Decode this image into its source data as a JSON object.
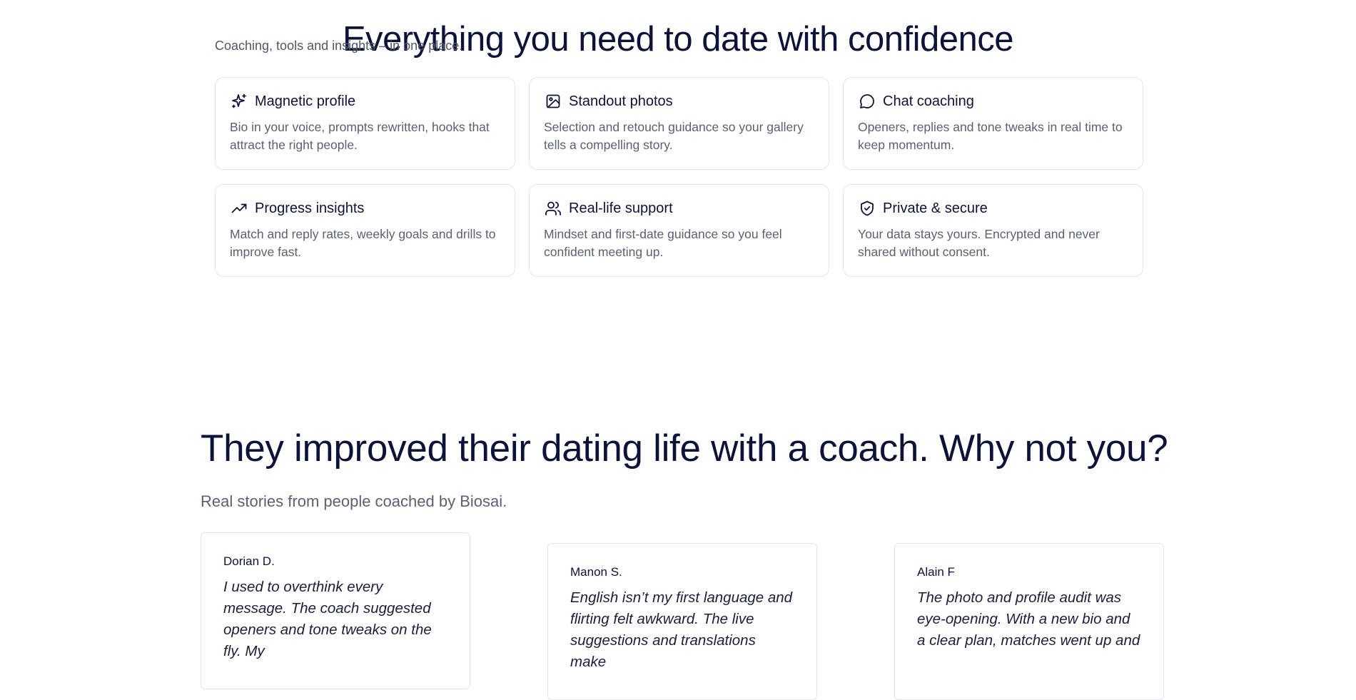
{
  "features": {
    "title": "Everything you need to date with confidence",
    "subtitle": "Coaching, tools and insights – in one place.",
    "cards": [
      {
        "icon": "sparkle-icon",
        "title": "Magnetic profile",
        "desc": "Bio in your voice, prompts rewritten, hooks that attract the right people."
      },
      {
        "icon": "image-icon",
        "title": "Standout photos",
        "desc": "Selection and retouch guidance so your gallery tells a compelling story."
      },
      {
        "icon": "chat-bubble-icon",
        "title": "Chat coaching",
        "desc": "Openers, replies and tone tweaks in real time to keep momentum."
      },
      {
        "icon": "trending-up-icon",
        "title": "Progress insights",
        "desc": "Match and reply rates, weekly goals and drills to improve fast."
      },
      {
        "icon": "users-icon",
        "title": "Real-life support",
        "desc": "Mindset and first-date guidance so you feel confident meeting up."
      },
      {
        "icon": "shield-check-icon",
        "title": "Private & secure",
        "desc": "Your data stays yours. Encrypted and never shared without consent."
      }
    ]
  },
  "testimonials": {
    "title": "They improved their dating life with a coach. Why not you?",
    "subtitle": "Real stories from people coached by Biosai.",
    "items": [
      {
        "name": "Dorian D.",
        "quote": "I used to overthink every message. The coach suggested openers and tone tweaks on the fly. My"
      },
      {
        "name": "Manon S.",
        "quote": "English isn’t my first language and flirting felt awkward. The live suggestions and translations make"
      },
      {
        "name": "Alain F",
        "quote": "The photo and profile audit was eye-opening. With a new bio and a clear plan, matches went up and"
      }
    ]
  },
  "colors": {
    "heading": "#0d1338",
    "body_text": "#5a6172",
    "card_border": "#e3e5ec",
    "background": "#ffffff"
  }
}
